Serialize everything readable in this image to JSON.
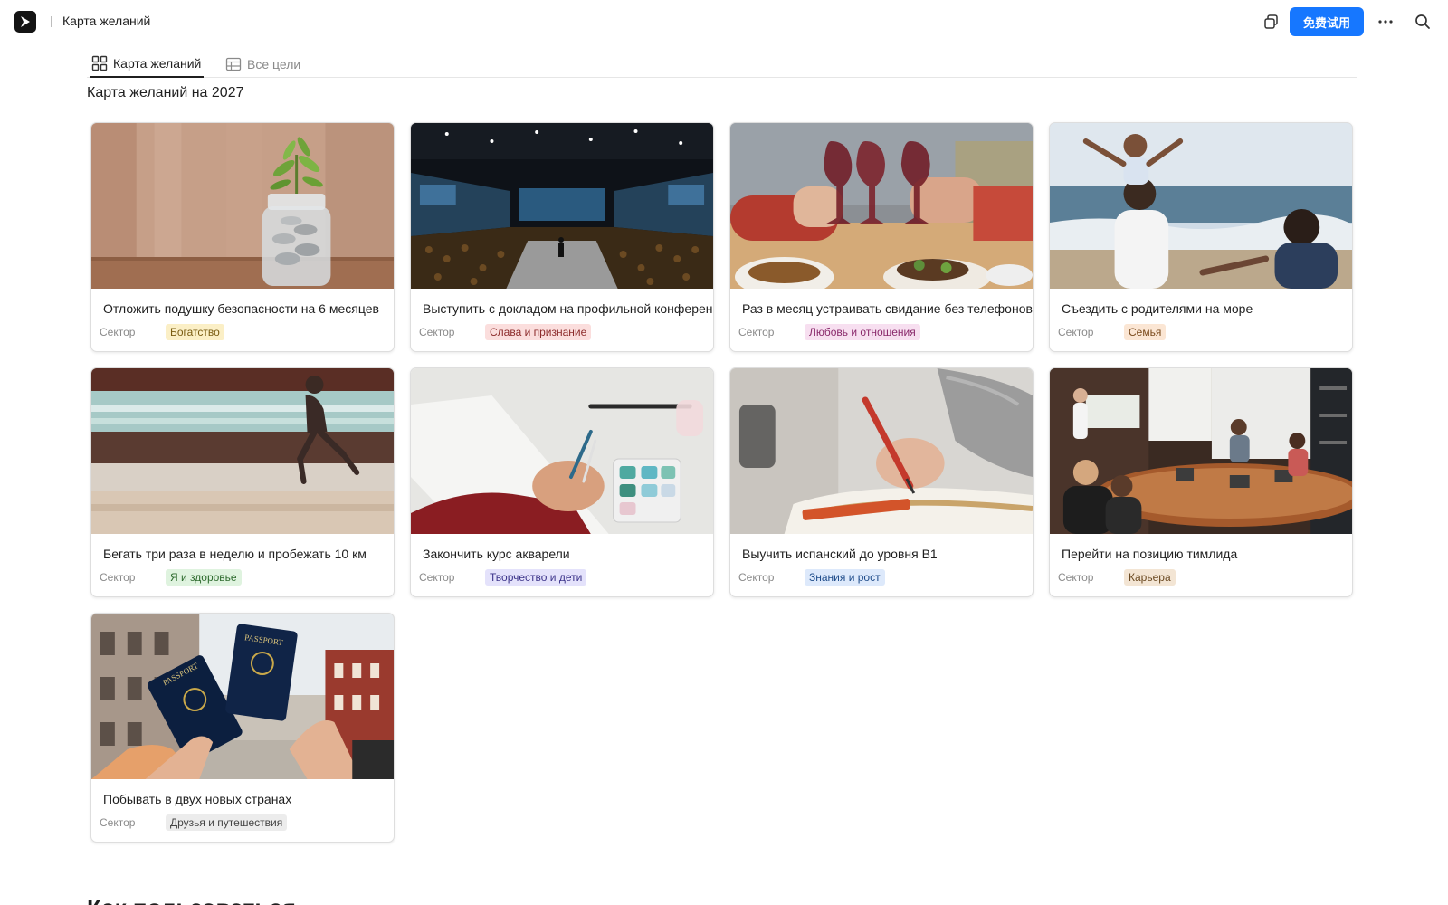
{
  "header": {
    "doc_title": "Карта желаний",
    "trial_button": "免费试用",
    "icons": [
      "app-logo-icon",
      "copy-icon",
      "more-icon",
      "search-icon"
    ]
  },
  "tabs": [
    {
      "label": "Карта желаний",
      "icon": "gallery-icon",
      "active": true
    },
    {
      "label": "Все цели",
      "icon": "table-icon",
      "active": false
    }
  ],
  "section_title": "Карта желаний на 2027",
  "field_label": "Сектор",
  "cards": [
    {
      "title": "Отложить подушку безопасности на 6 месяцев",
      "sector": "Богатство",
      "tag_bg": "#fbefc6",
      "tag_fg": "#7a5c12",
      "image": "savings-jar"
    },
    {
      "title": "Выступить с докладом на профильной конференции",
      "sector": "Слава и признание",
      "tag_bg": "#fbdedd",
      "tag_fg": "#8c2b2b",
      "image": "conference-stage"
    },
    {
      "title": "Раз в месяц устраивать свидание без телефонов",
      "sector": "Любовь и отношения",
      "tag_bg": "#f7dff0",
      "tag_fg": "#8a2a6c",
      "image": "wine-toast"
    },
    {
      "title": "Съездить с родителями на море",
      "sector": "Семья",
      "tag_bg": "#fbe6d4",
      "tag_fg": "#7a4a1c",
      "image": "family-beach"
    },
    {
      "title": "Бегать три раза в неделю и пробежать 10 км",
      "sector": "Я и здоровье",
      "tag_bg": "#dff3df",
      "tag_fg": "#2d6a2d",
      "image": "runner"
    },
    {
      "title": "Закончить курс акварели",
      "sector": "Творчество и дети",
      "tag_bg": "#e4e2fb",
      "tag_fg": "#3c348a",
      "image": "watercolor"
    },
    {
      "title": "Выучить испанский до уровня B1",
      "sector": "Знания и рост",
      "tag_bg": "#dde9fb",
      "tag_fg": "#1f4c8a",
      "image": "writing-notebook"
    },
    {
      "title": "Перейти на позицию тимлида",
      "sector": "Карьера",
      "tag_bg": "#f3e5d4",
      "tag_fg": "#6b4a22",
      "image": "meeting-room"
    },
    {
      "title": "Побывать в двух новых странах",
      "sector": "Друзья и путешествия",
      "tag_bg": "#ececec",
      "tag_fg": "#444444",
      "image": "passports",
      "passport_text": "PASSPORT"
    }
  ],
  "next_section_heading": "Как пользоваться"
}
